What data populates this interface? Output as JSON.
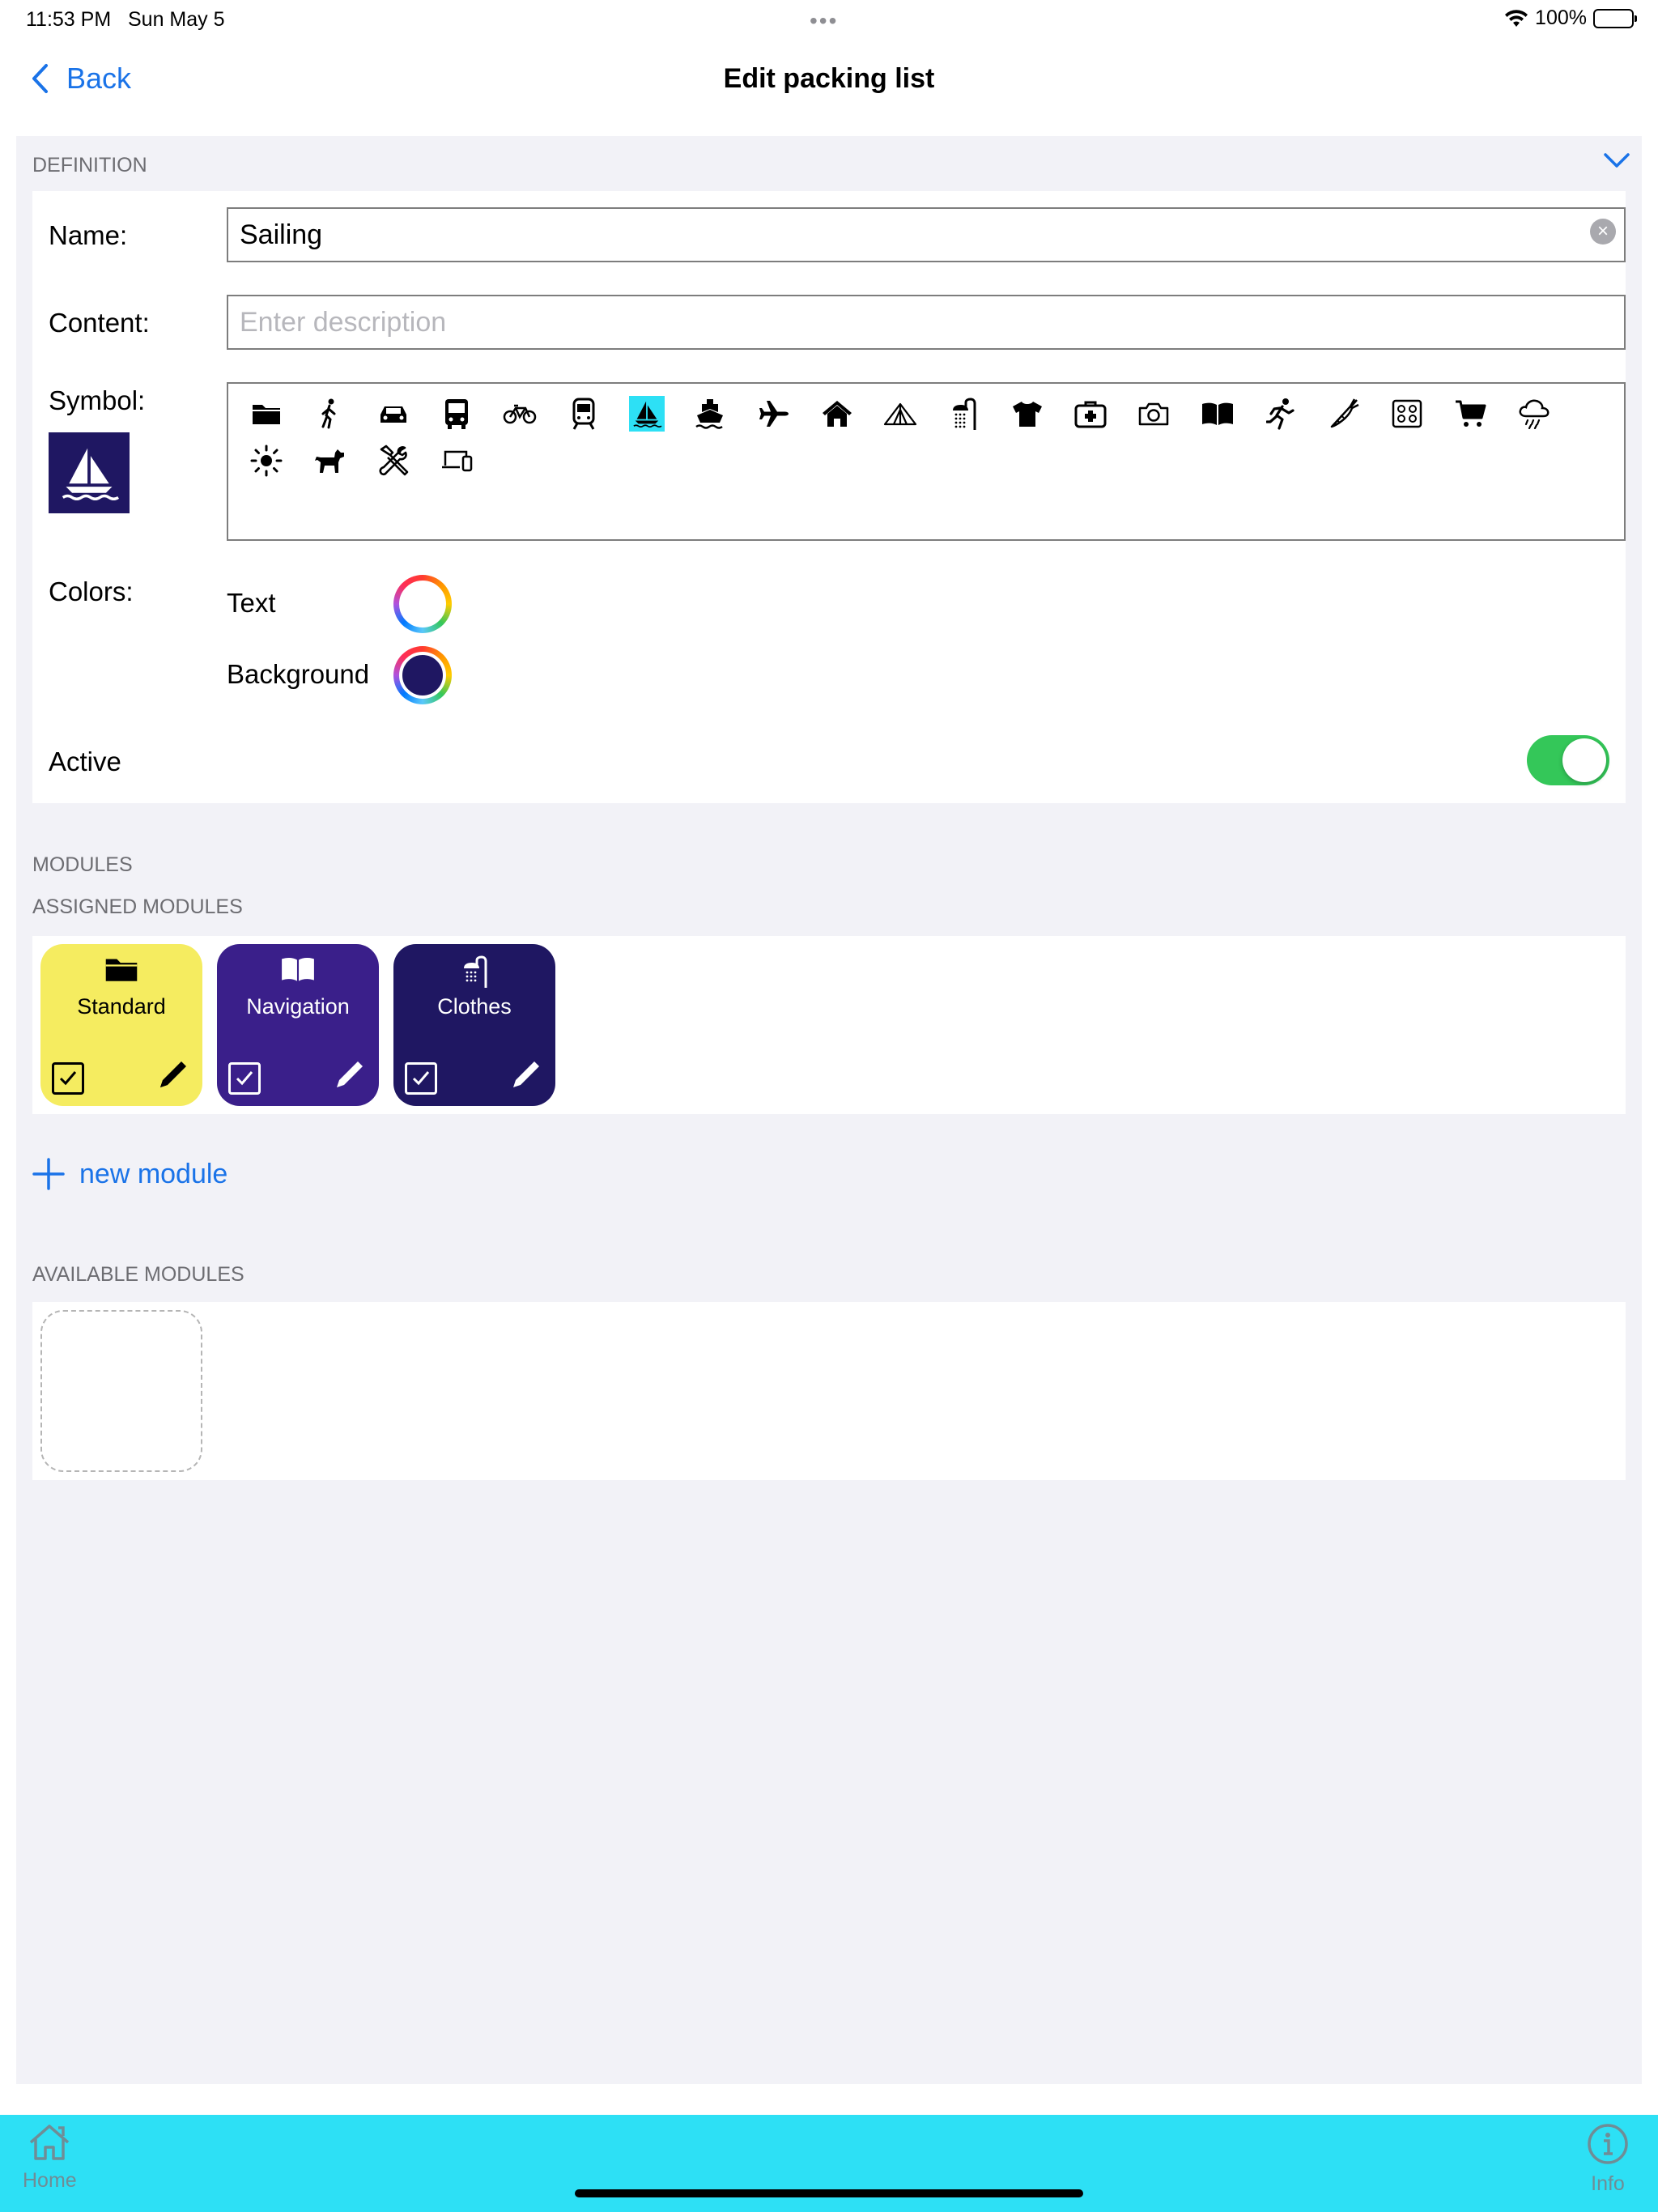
{
  "status_bar": {
    "time": "11:53 PM",
    "date": "Sun May 5",
    "battery": "100%"
  },
  "nav": {
    "back_label": "Back",
    "title": "Edit packing list"
  },
  "definition": {
    "header": "DEFINITION",
    "name_label": "Name:",
    "name_value": "Sailing",
    "content_label": "Content:",
    "content_placeholder": "Enter description",
    "symbol_label": "Symbol:",
    "symbols": [
      "folder",
      "walking",
      "car",
      "bus",
      "bicycle",
      "train",
      "sailboat",
      "ship",
      "airplane",
      "house",
      "tent",
      "shower",
      "tshirt",
      "first-aid",
      "camera",
      "book",
      "running",
      "carrot",
      "stove",
      "cart",
      "rain",
      "sun",
      "dog",
      "tools",
      "devices"
    ],
    "selected_symbol": "sailboat",
    "preview_background": "#1f1762",
    "colors_label": "Colors:",
    "text_color_label": "Text",
    "text_color": "#ffffff",
    "background_color_label": "Background",
    "background_color": "#1f1762",
    "active_label": "Active",
    "active": true
  },
  "modules": {
    "header": "MODULES",
    "assigned_header": "ASSIGNED MODULES",
    "assigned": [
      {
        "label": "Standard",
        "icon": "folder-icon",
        "bg": "#f5ec60",
        "fg": "#000000"
      },
      {
        "label": "Navigation",
        "icon": "book-icon",
        "bg": "#3a1f8a",
        "fg": "#ffffff"
      },
      {
        "label": "Clothes",
        "icon": "shower-icon",
        "bg": "#1f1762",
        "fg": "#ffffff"
      }
    ],
    "new_module_label": "new module",
    "available_header": "AVAILABLE MODULES"
  },
  "tabbar": {
    "home_label": "Home",
    "info_label": "Info",
    "background": "#2de0f5"
  }
}
